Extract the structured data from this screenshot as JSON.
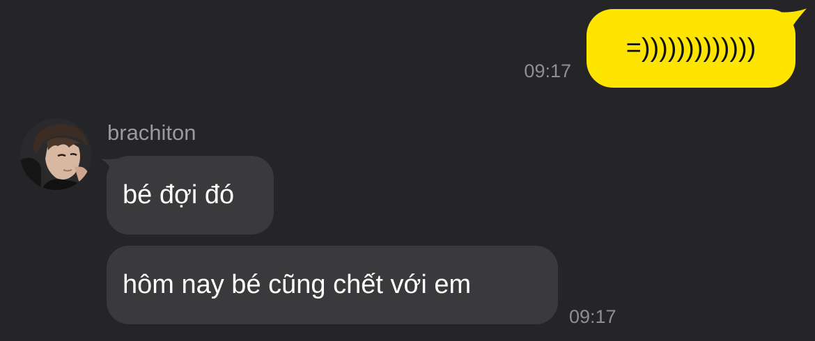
{
  "colors": {
    "background": "#252527",
    "outgoing_bubble": "#FEE500",
    "incoming_bubble": "#3a3a3c",
    "timestamp": "#8e8e93",
    "sender_name": "#9a9a9e"
  },
  "messages": {
    "outgoing": {
      "text": "=)))))))))))))",
      "time": "09:17"
    },
    "incoming": {
      "sender": "brachiton",
      "avatar_icon": "profile-photo",
      "first": {
        "text": "bé đợi đó"
      },
      "second": {
        "text": "hôm nay bé cũng chết với em",
        "time": "09:17"
      }
    }
  }
}
